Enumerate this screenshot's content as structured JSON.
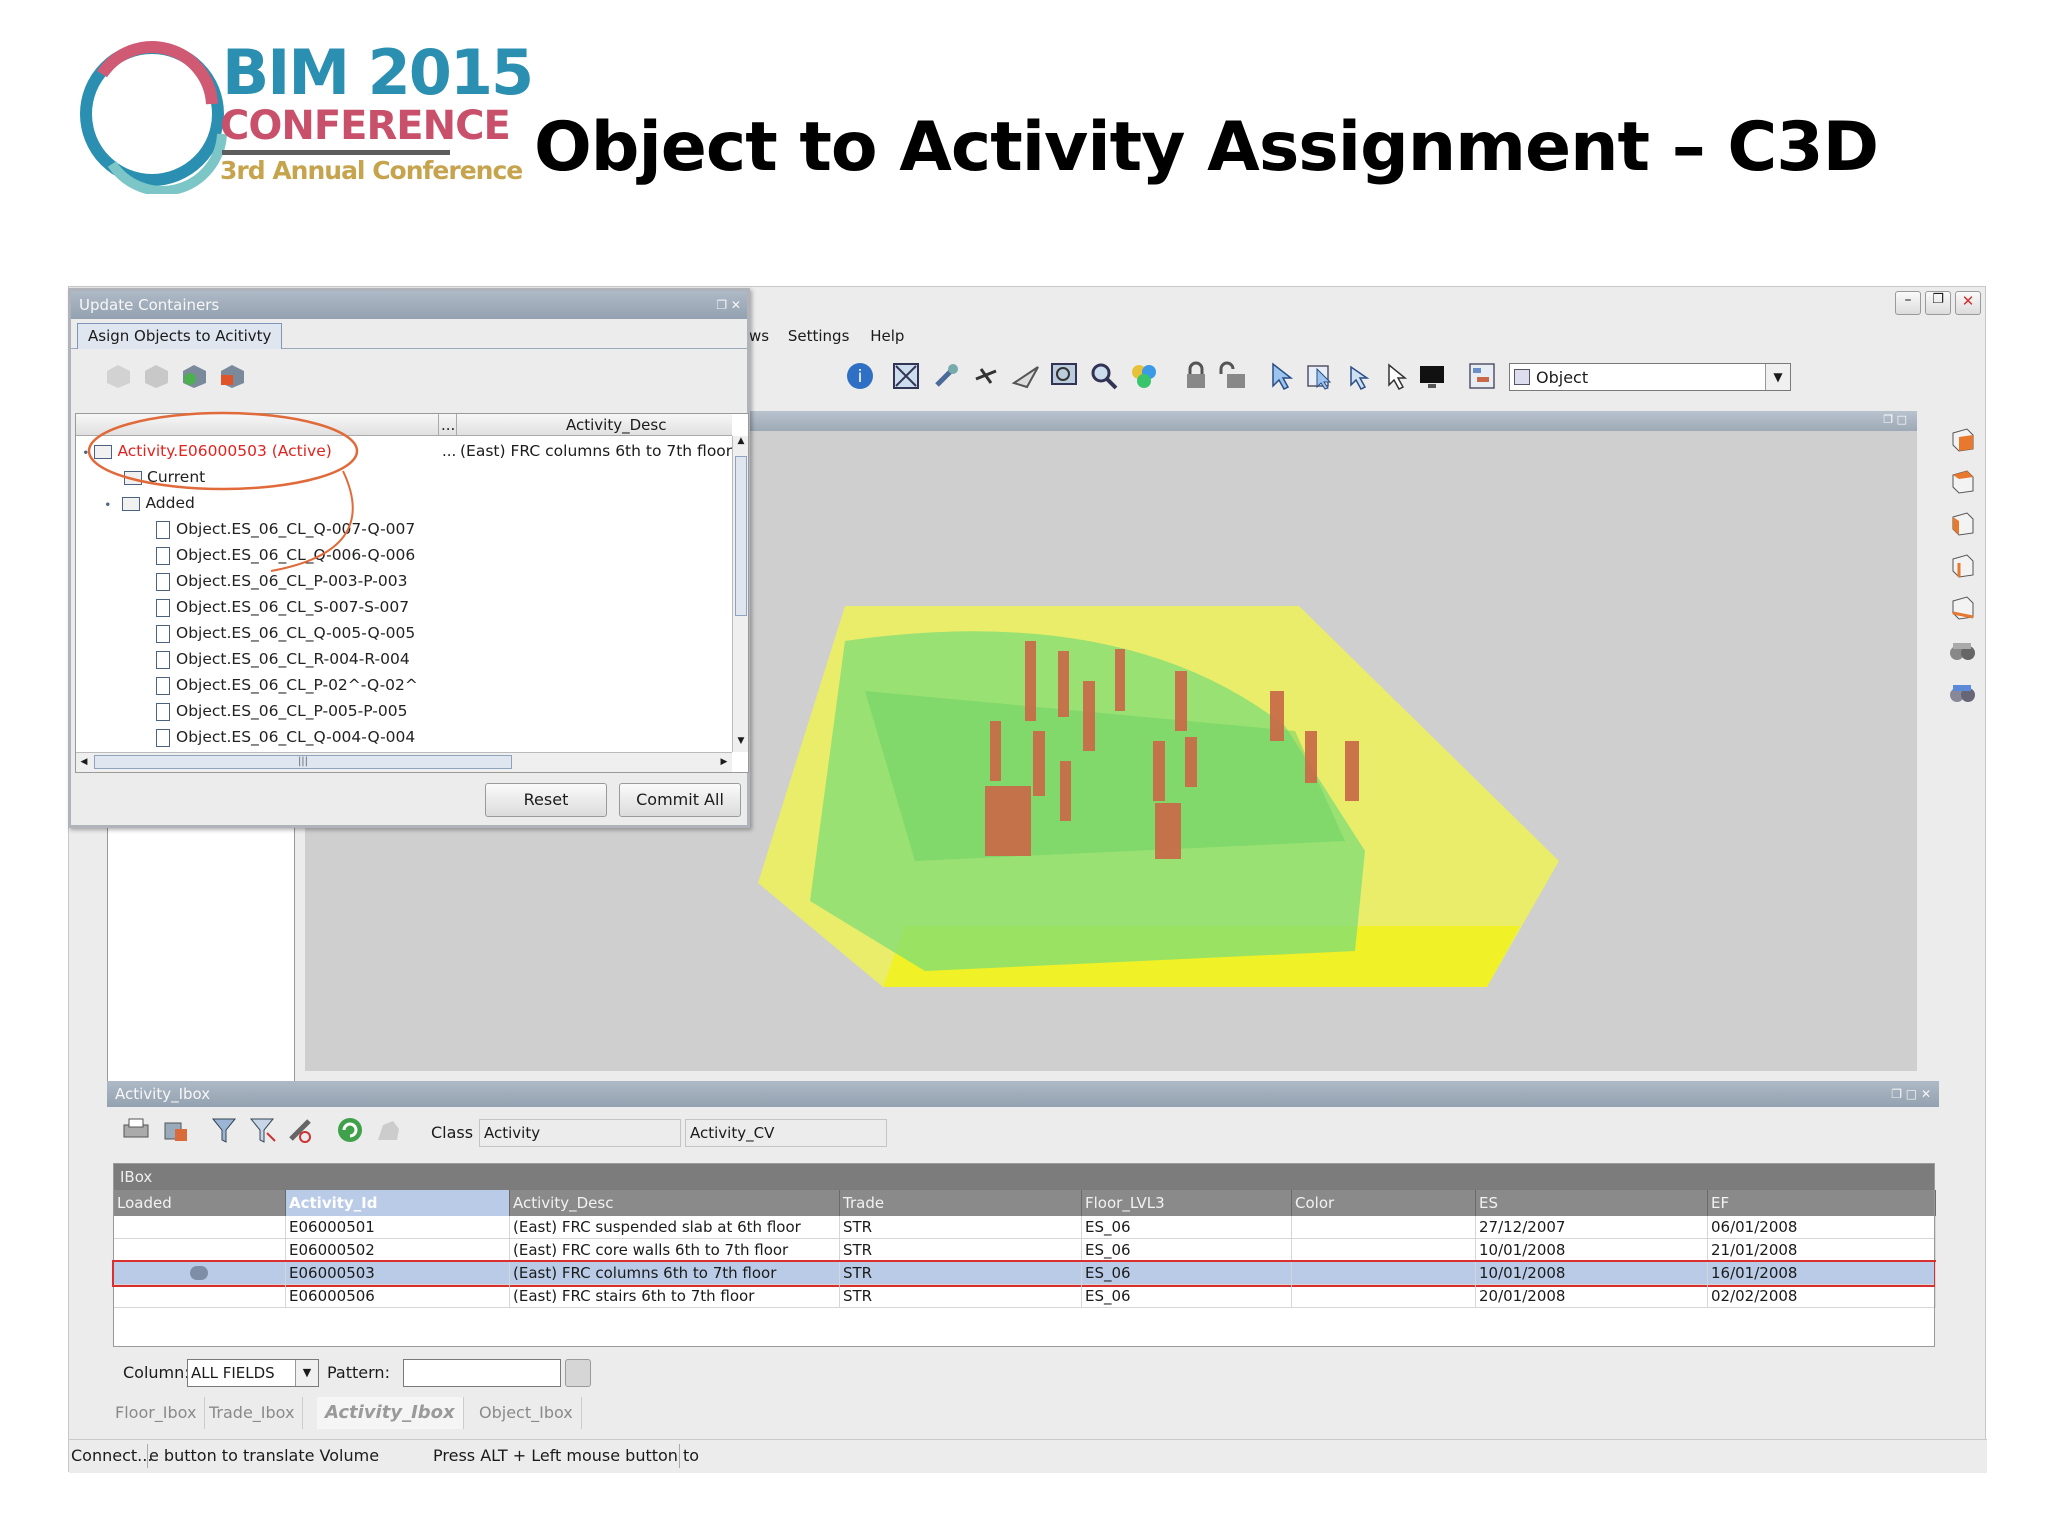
{
  "slide": {
    "logo": {
      "bim": "BIM 2015",
      "conference": "CONFERENCE",
      "annual": "3rd Annual Conference"
    },
    "title": "Object to Activity Assignment – C3D"
  },
  "app": {
    "menu": [
      "ws",
      "Settings",
      "Help"
    ],
    "object_select": {
      "value": "Object"
    },
    "statusbar": {
      "left": "Connect...",
      "middle": "e button to translate Volume",
      "right": "Press ALT + Left mouse button to"
    }
  },
  "update_containers": {
    "title": "Update Containers",
    "tab": "Asign Objects to Acitivty",
    "column_header": "Activity_Desc",
    "column_more": "...",
    "root": {
      "label": "Activity.E06000503 (Active)",
      "desc": "(East) FRC columns 6th to 7th floor",
      "more": "..."
    },
    "current_label": "Current",
    "added_label": "Added",
    "objects": [
      "Object.ES_06_CL_Q-007-Q-007",
      "Object.ES_06_CL_Q-006-Q-006",
      "Object.ES_06_CL_P-003-P-003",
      "Object.ES_06_CL_S-007-S-007",
      "Object.ES_06_CL_Q-005-Q-005",
      "Object.ES_06_CL_R-004-R-004",
      "Object.ES_06_CL_P-02^-Q-02^",
      "Object.ES_06_CL_P-005-P-005",
      "Object.ES_06_CL_Q-004-Q-004"
    ],
    "scroll_mid": "|||",
    "reset_label": "Reset",
    "commit_label": "Commit All"
  },
  "activity_ibox": {
    "title": "Activity_Ibox",
    "class_label": "Class",
    "class_value": "Activity",
    "cv_value": "Activity_CV",
    "ibox_label": "IBox",
    "columns": [
      "Loaded",
      "Activity_Id",
      "Activity_Desc",
      "Trade",
      "Floor_LVL3",
      "Color",
      "ES",
      "EF"
    ],
    "rows": [
      {
        "loaded": "",
        "id": "E06000501",
        "desc": "(East) FRC suspended slab at 6th floor",
        "trade": "STR",
        "floor": "ES_06",
        "color": "",
        "es": "27/12/2007",
        "ef": "06/01/2008"
      },
      {
        "loaded": "",
        "id": "E06000502",
        "desc": "(East) FRC core walls 6th to 7th floor",
        "trade": "STR",
        "floor": "ES_06",
        "color": "",
        "es": "10/01/2008",
        "ef": "21/01/2008"
      },
      {
        "loaded": "loaded",
        "id": "E06000503",
        "desc": "(East) FRC columns 6th to 7th floor",
        "trade": "STR",
        "floor": "ES_06",
        "color": "",
        "es": "10/01/2008",
        "ef": "16/01/2008"
      },
      {
        "loaded": "",
        "id": "E06000506",
        "desc": "(East) FRC stairs 6th to 7th floor",
        "trade": "STR",
        "floor": "ES_06",
        "color": "",
        "es": "20/01/2008",
        "ef": "02/02/2008"
      }
    ],
    "selected_row": 2,
    "filter": {
      "column_label": "Column:",
      "column_value": "ALL FIELDS",
      "pattern_label": "Pattern:",
      "pattern_value": ""
    },
    "tabs": [
      "Floor_Ibox",
      "Trade_Ibox",
      "Activity_Ibox",
      "Object_Ibox"
    ],
    "active_tab": 2
  },
  "colors": {
    "selected_row": "#b9cbe6",
    "highlight_border": "#d9302f",
    "panel_title": "#9aa7b5",
    "columns_fill": "#c4694c",
    "envelope": "#eef05a",
    "structure": "#7fe07f"
  }
}
